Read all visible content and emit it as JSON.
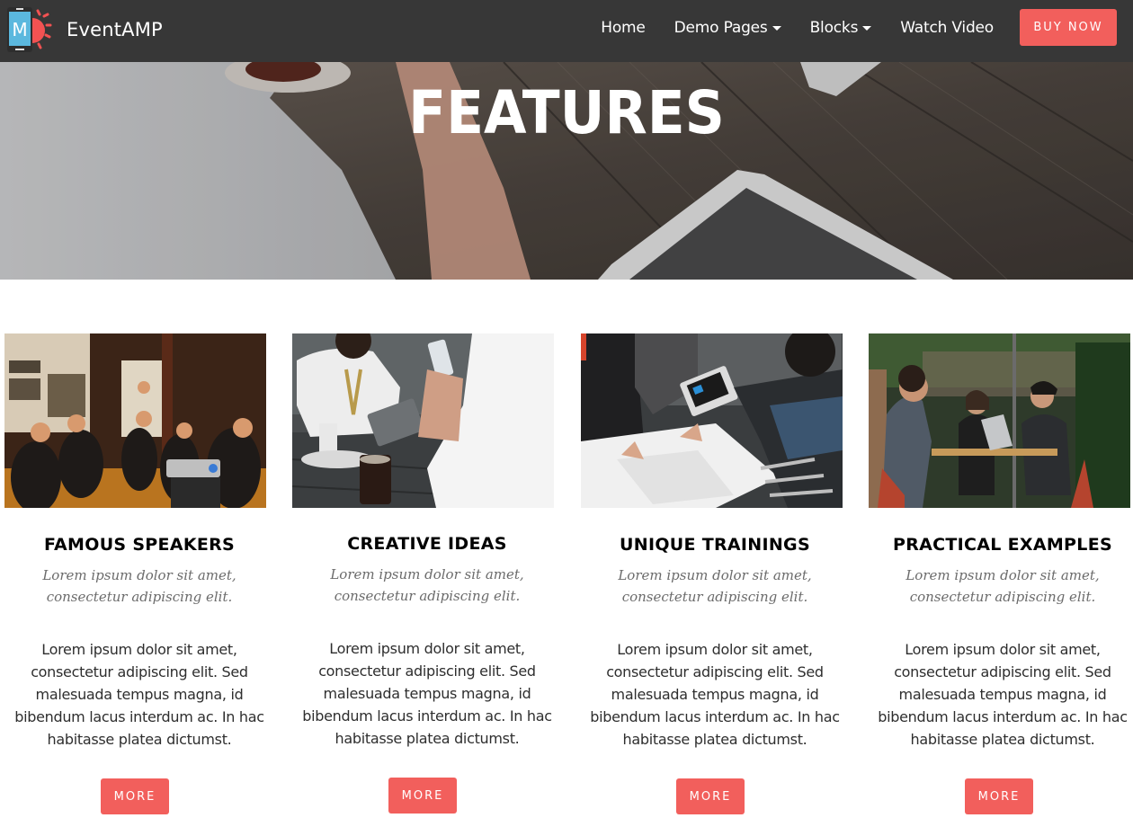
{
  "navbar": {
    "brand_name": "EventAMP",
    "logo_letter": "M",
    "links": [
      {
        "label": "Home",
        "has_dropdown": false
      },
      {
        "label": "Demo Pages",
        "has_dropdown": true
      },
      {
        "label": "Blocks",
        "has_dropdown": true
      },
      {
        "label": "Watch Video",
        "has_dropdown": false
      }
    ],
    "cta_label": "BUY NOW"
  },
  "hero": {
    "title": "FEATURES"
  },
  "features": [
    {
      "title": "FAMOUS SPEAKERS",
      "subtitle": "Lorem ipsum dolor sit amet, consectetur adipiscing elit.",
      "text": "Lorem ipsum dolor sit amet, consectetur adipiscing elit. Sed malesuada tempus magna, id bibendum lacus interdum ac. In hac habitasse platea dictumst.",
      "button_label": "MORE",
      "image_alt": "audience-at-presentation-photo"
    },
    {
      "title": "CREATIVE IDEAS",
      "subtitle": "Lorem ipsum dolor sit amet, consectetur adipiscing elit.",
      "text": "Lorem ipsum dolor sit amet, consectetur adipiscing elit. Sed malesuada tempus magna, id bibendum lacus interdum ac. In hac habitasse platea dictumst.",
      "button_label": "MORE",
      "image_alt": "people-at-cafe-table-with-devices-photo"
    },
    {
      "title": "UNIQUE TRAININGS",
      "subtitle": "Lorem ipsum dolor sit amet, consectetur adipiscing elit.",
      "text": "Lorem ipsum dolor sit amet, consectetur adipiscing elit. Sed malesuada tempus magna, id bibendum lacus interdum ac. In hac habitasse platea dictumst.",
      "button_label": "MORE",
      "image_alt": "team-reviewing-papers-and-laptop-photo"
    },
    {
      "title": "PRACTICAL EXAMPLES",
      "subtitle": "Lorem ipsum dolor sit amet, consectetur adipiscing elit.",
      "text": "Lorem ipsum dolor sit amet, consectetur adipiscing elit. Sed malesuada tempus magna, id bibendum lacus interdum ac. In hac habitasse platea dictumst.",
      "button_label": "MORE",
      "image_alt": "friends-at-outdoor-cafe-with-laptop-photo"
    }
  ],
  "colors": {
    "navbar_bg": "#373737",
    "accent": "#f25f5c",
    "logo_blue": "#5bb8de"
  }
}
